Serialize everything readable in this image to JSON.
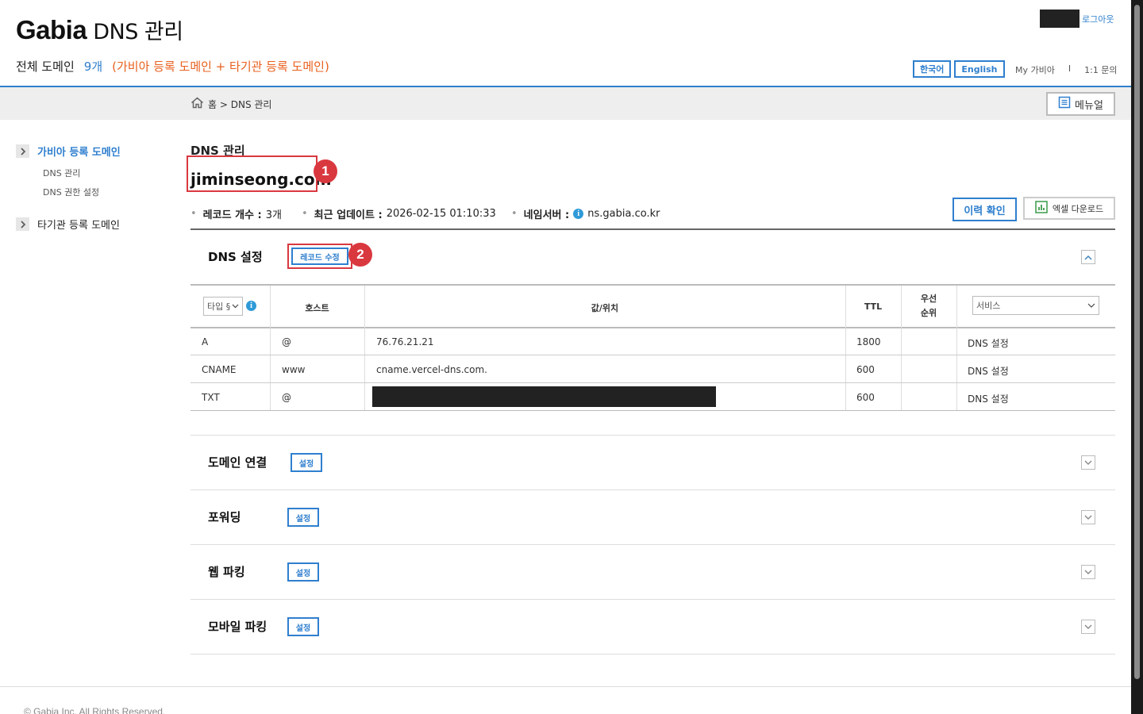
{
  "header": {
    "brand": "Gabia",
    "title": "DNS 관리",
    "logout": "로그아웃",
    "total_label": "전체 도메인",
    "total_count": "9개",
    "total_desc": "(가비아 등록 도메인 + 타기관 등록 도메인)",
    "lang_ko": "한국어",
    "lang_en": "English",
    "my_gabia": "My 가비아",
    "separator": "I",
    "inquiry": "1:1 문의"
  },
  "breadcrumb": {
    "text": "홈 > DNS 관리"
  },
  "menu_button": "메뉴얼",
  "sidebar": {
    "group1": "가비아 등록 도메인",
    "sub1": "DNS 관리",
    "sub2": "DNS 권한 설정",
    "group2": "타기관 등록 도메인"
  },
  "main": {
    "page_title": "DNS 관리",
    "domain": "jiminseong.com",
    "record_count_label": "레코드 개수 :",
    "record_count": "3개",
    "last_update_label": "최근 업데이트 :",
    "last_update": "2026-02-15 01:10:33",
    "nameserver_label": "네임서버 :",
    "nameserver": "ns.gabia.co.kr",
    "history_button": "이력 확인",
    "excel_button": "엑셀 다운로드"
  },
  "annotations": {
    "n1": "1",
    "n2": "2"
  },
  "dns_section": {
    "title": "DNS 설정",
    "edit_button": "레코드 수정",
    "type_select": "타입 §",
    "columns": {
      "host": "호스트",
      "value": "값/위치",
      "ttl": "TTL",
      "priority": "우선 순위"
    },
    "service_select": "서비스",
    "rows": [
      {
        "type": "A",
        "host": "@",
        "value": "76.76.21.21",
        "ttl": "1800",
        "priority": "",
        "service": "DNS 설정"
      },
      {
        "type": "CNAME",
        "host": "www",
        "value": "cname.vercel-dns.com.",
        "ttl": "600",
        "priority": "",
        "service": "DNS 설정"
      },
      {
        "type": "TXT",
        "host": "@",
        "value": "",
        "ttl": "600",
        "priority": "",
        "service": "DNS 설정"
      }
    ]
  },
  "sections": [
    {
      "title": "도메인 연결",
      "button": "설정"
    },
    {
      "title": "포워딩",
      "button": "설정"
    },
    {
      "title": "웹 파킹",
      "button": "설정"
    },
    {
      "title": "모바일 파킹",
      "button": "설정"
    }
  ],
  "footer": "© Gabia Inc. All Rights Reserved.",
  "colors": {
    "accent": "#2f7fce",
    "orange": "#e8601e",
    "highlight": "#d9383f"
  },
  "icons": [
    "home-icon",
    "manual-icon",
    "chevron-right-icon",
    "info-icon",
    "excel-icon",
    "chevron-up-icon",
    "chevron-down-icon"
  ]
}
